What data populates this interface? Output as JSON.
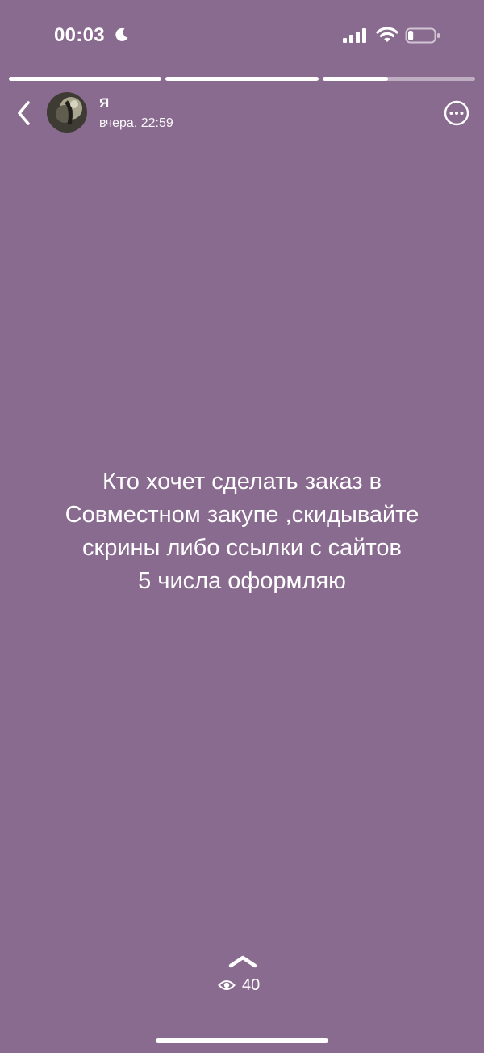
{
  "status_bar": {
    "time": "00:03",
    "icons": [
      "moon-icon",
      "signal-icon",
      "wifi-icon",
      "battery-icon"
    ],
    "battery_level": 0.2
  },
  "story": {
    "progress": [
      1.0,
      1.0,
      0.43
    ],
    "author": "Я",
    "time": "вчера, 22:59",
    "text_lines": [
      "Кто хочет сделать заказ в",
      "Совместном закупе ,скидывайте",
      "скрины либо ссылки с сайтов",
      "5 числа оформляю"
    ],
    "background_color": "#8a6b90"
  },
  "footer": {
    "views": "40"
  }
}
